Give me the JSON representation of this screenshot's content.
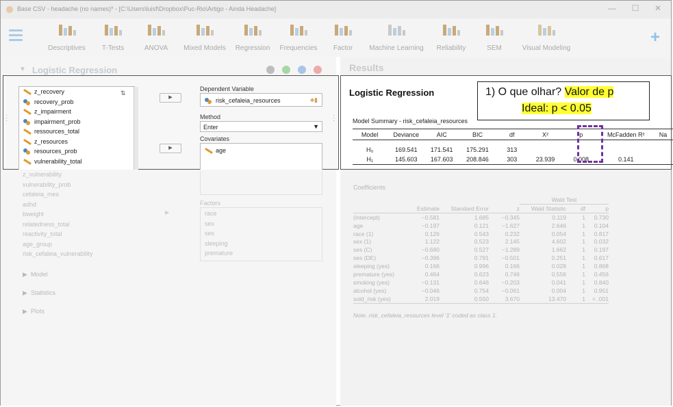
{
  "window": {
    "title": "Base CSV - headache (no names)* - [C:\\Users\\luisf\\Dropbox\\Puc-Rio\\Artigo - Ainda Headache]"
  },
  "toolbar": {
    "items": [
      "Descriptives",
      "T-Tests",
      "ANOVA",
      "Mixed Models",
      "Regression",
      "Frequencies",
      "Factor",
      "Machine Learning",
      "Reliability",
      "SEM",
      "Visual Modeling"
    ]
  },
  "analysis": {
    "title": "Logistic Regression"
  },
  "results": {
    "pane_title": "Results",
    "heading": "Logistic Regression"
  },
  "variables": [
    "z_recovery",
    "recovery_prob",
    "z_impairment",
    "impairment_prob",
    "ressources_total",
    "z_resources",
    "resources_prob",
    "vulnerability_total"
  ],
  "variable_icons": [
    "pencil",
    "nom",
    "pencil",
    "nom",
    "pencil",
    "pencil",
    "nom",
    "pencil"
  ],
  "variables_faded": [
    "z_vulnerability",
    "vulnerability_prob",
    "cefaleia_mes",
    "adhd",
    "bweight",
    "relatedness_total",
    "reactivity_total",
    "age_group",
    "risk_cefaleia_vulnerability"
  ],
  "form": {
    "dependent_label": "Dependent Variable",
    "dependent_value": "risk_cefaleia_resources",
    "method_label": "Method",
    "method_value": "Enter",
    "covariates_label": "Covariates",
    "covariate_value": "age",
    "factors_label": "Factors",
    "factors": [
      "race",
      "sex",
      "ses",
      "sleeping",
      "premature"
    ]
  },
  "sections": [
    "Model",
    "Statistics",
    "Plots"
  ],
  "callout": {
    "line1_plain": "1) O que olhar? ",
    "line1_hl": "Valor de p",
    "line2": "Ideal: p  < 0.05"
  },
  "model_summary": {
    "caption": "Model Summary - risk_cefaleia_resources",
    "headers": [
      "Model",
      "Deviance",
      "AIC",
      "BIC",
      "df",
      "X²",
      "p",
      "McFadden R²",
      "Na"
    ],
    "rows": [
      [
        "H₀",
        "169.541",
        "171.541",
        "175.291",
        "313",
        "",
        "",
        "",
        ""
      ],
      [
        "H₁",
        "145.603",
        "167.603",
        "208.846",
        "303",
        "23.939",
        "0.008",
        "0.141",
        ""
      ]
    ]
  },
  "coefficients": {
    "title": "Coefficients",
    "wald_header": "Wald Test",
    "headers": [
      "",
      "Estimate",
      "Standard Error",
      "z",
      "Wald Statistic",
      "df",
      "p"
    ],
    "rows": [
      [
        "(Intercept)",
        "−0.581",
        "1.685",
        "−0.345",
        "0.119",
        "1",
        "0.730"
      ],
      [
        "age",
        "−0.197",
        "0.121",
        "−1.627",
        "2.646",
        "1",
        "0.104"
      ],
      [
        "race (1)",
        "0.126",
        "0.543",
        "0.232",
        "0.054",
        "1",
        "0.817"
      ],
      [
        "sex (1)",
        "1.122",
        "0.523",
        "2.145",
        "4.602",
        "1",
        "0.032"
      ],
      [
        "ses (C)",
        "−0.680",
        "0.527",
        "−1.289",
        "1.662",
        "1",
        "0.197"
      ],
      [
        "ses (DE)",
        "−0.396",
        "0.791",
        "−0.501",
        "0.251",
        "1",
        "0.617"
      ],
      [
        "sleeping (yes)",
        "0.166",
        "0.996",
        "0.166",
        "0.028",
        "1",
        "0.868"
      ],
      [
        "premature (yes)",
        "0.464",
        "0.623",
        "0.746",
        "0.556",
        "1",
        "0.456"
      ],
      [
        "smoking (yes)",
        "−0.131",
        "0.646",
        "−0.203",
        "0.041",
        "1",
        "0.840"
      ],
      [
        "alcohol (yes)",
        "−0.046",
        "0.754",
        "−0.061",
        "0.004",
        "1",
        "0.951"
      ],
      [
        "sold_risk (yes)",
        "2.019",
        "0.550",
        "3.670",
        "13.470",
        "1",
        "< .001"
      ]
    ],
    "note": "Note. risk_cefaleia_resources level '1' coded as class 1."
  }
}
